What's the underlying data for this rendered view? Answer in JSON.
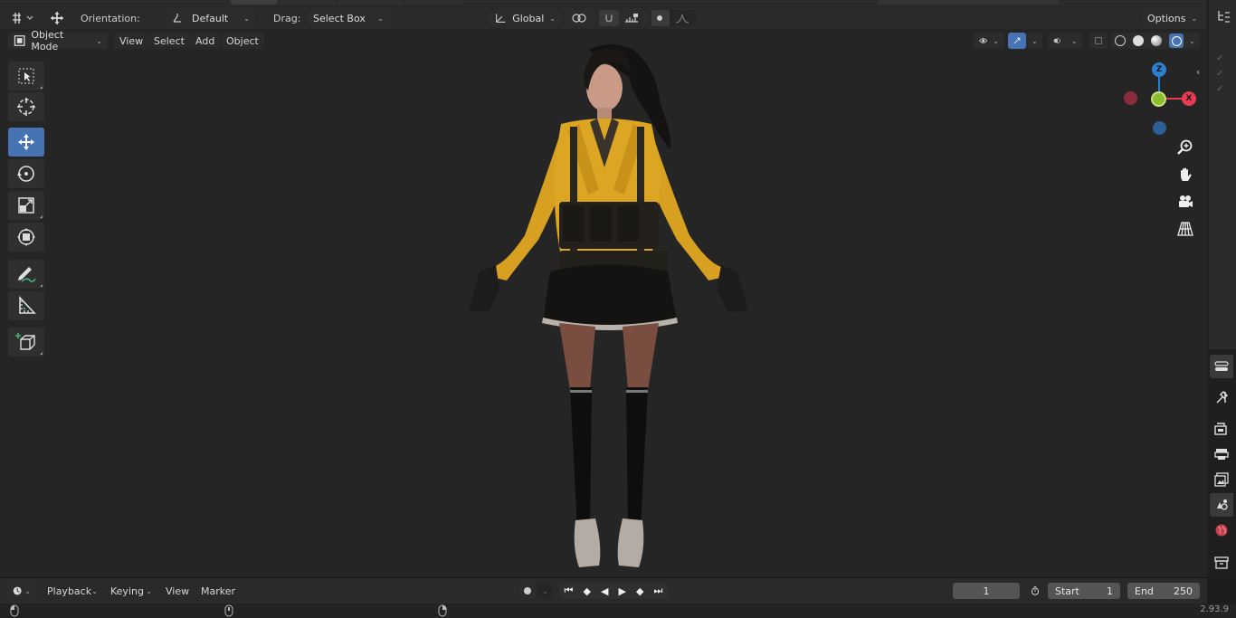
{
  "top_header": {
    "orientation_label": "Orientation:",
    "orientation_value": "Default",
    "drag_label": "Drag:",
    "drag_value": "Select Box",
    "transform_orientation": "Global",
    "options_label": "Options"
  },
  "viewport_header": {
    "mode": "Object Mode",
    "menus": [
      "View",
      "Select",
      "Add",
      "Object"
    ]
  },
  "gizmo": {
    "z_label": "Z",
    "x_label": "X",
    "colors": {
      "x": "#e83b52",
      "y": "#8bbf31",
      "z": "#2d7fd2"
    }
  },
  "timeline": {
    "menus": [
      "Playback",
      "Keying",
      "View",
      "Marker"
    ],
    "current_frame": "1",
    "start_label": "Start",
    "start_value": "1",
    "end_label": "End",
    "end_value": "250"
  },
  "status_bar": {
    "version": "2.93.9"
  },
  "icons": {
    "toolbar": [
      "select-box-icon",
      "cursor-icon",
      "move-icon",
      "rotate-icon",
      "scale-icon",
      "transform-icon",
      "annotate-icon",
      "measure-icon",
      "add-cube-icon"
    ],
    "navigate": [
      "zoom-icon",
      "pan-hand-icon",
      "camera-icon",
      "grid-perspective-icon"
    ],
    "properties": [
      "tool-properties-icon",
      "render-icon",
      "output-icon",
      "view-layer-icon",
      "scene-icon",
      "world-icon",
      "collection-icon"
    ]
  },
  "accent_color": "#4772b3"
}
